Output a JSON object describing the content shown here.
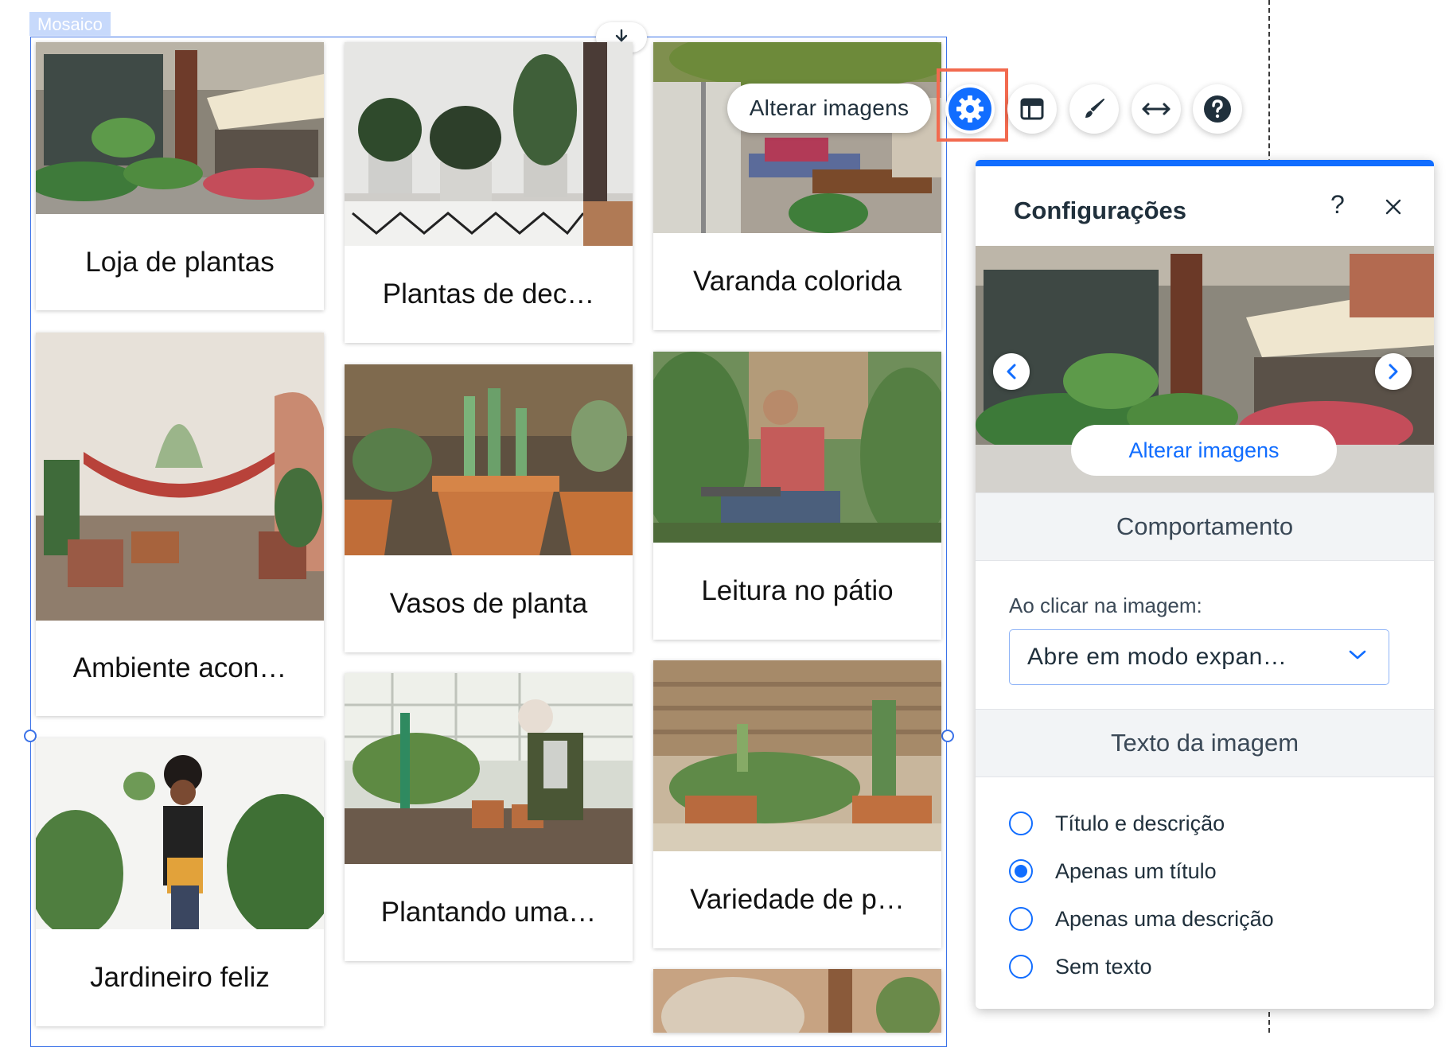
{
  "widget": {
    "tag": "Mosaico"
  },
  "gallery": {
    "items": [
      {
        "title": "Loja de plantas"
      },
      {
        "title": "Plantas de dec…"
      },
      {
        "title": "Varanda colorida"
      },
      {
        "title": "Ambiente acon…"
      },
      {
        "title": "Vasos de planta"
      },
      {
        "title": "Leitura no pátio"
      },
      {
        "title": "Jardineiro feliz"
      },
      {
        "title": "Plantando uma…"
      },
      {
        "title": "Variedade de p…"
      }
    ]
  },
  "toolbar": {
    "change_images": "Alterar imagens",
    "icons": [
      "download-icon",
      "gear-icon",
      "layout-icon",
      "brush-icon",
      "stretch-icon",
      "help-icon"
    ]
  },
  "panel": {
    "title": "Configurações",
    "help": "?",
    "change_images": "Alterar imagens",
    "behavior": {
      "heading": "Comportamento",
      "label": "Ao clicar na imagem:",
      "selected": "Abre em modo expan…"
    },
    "image_text": {
      "heading": "Texto da imagem",
      "options": [
        {
          "label": "Título e descrição",
          "checked": false
        },
        {
          "label": "Apenas um título",
          "checked": true
        },
        {
          "label": "Apenas uma descrição",
          "checked": false
        },
        {
          "label": "Sem texto",
          "checked": false
        }
      ]
    }
  },
  "colors": {
    "accent": "#116dff",
    "highlight": "#f26a4f",
    "selection": "#3b72e8"
  }
}
